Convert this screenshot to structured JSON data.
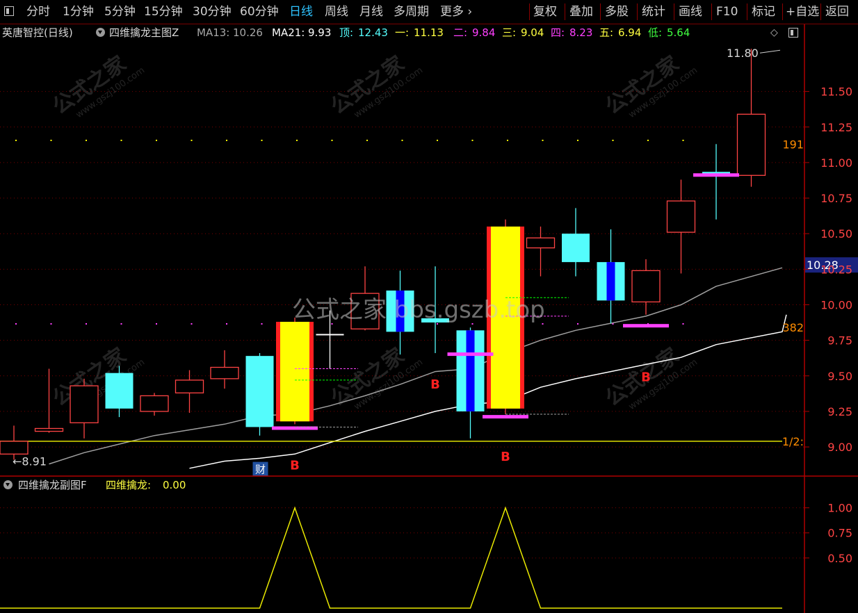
{
  "toolbar": {
    "left_items": [
      "分时",
      "1分钟",
      "5分钟",
      "15分钟",
      "30分钟",
      "60分钟",
      "日线",
      "周线",
      "月线",
      "多周期",
      "更多"
    ],
    "active_index": 6,
    "right_items": [
      "复权",
      "叠加",
      "多股",
      "统计",
      "画线",
      "F10",
      "标记",
      "+自选",
      "返回"
    ]
  },
  "header": {
    "stock": "英唐智控(日线)",
    "indicator": "四维擒龙主图Z",
    "ma13_label": "MA13:",
    "ma13_value": "10.26",
    "ma21_label": "MA21:",
    "ma21_value": "9.93",
    "top_label": "顶:",
    "top_value": "12.43",
    "l1_label": "一:",
    "l1_value": "11.13",
    "l2_label": "二:",
    "l2_value": "9.84",
    "l3_label": "三:",
    "l3_value": "9.04",
    "l4_label": "四:",
    "l4_value": "8.23",
    "l5_label": "五:",
    "l5_value": "6.94",
    "low_label": "低:",
    "low_value": "5.64"
  },
  "sub_header": {
    "indicator": "四维擒龙副图F",
    "value_label": "四维擒龙:",
    "value": "0.00"
  },
  "watermark": {
    "logo": "公式之家",
    "url": "www.gszj100.com",
    "center": "公式之家 bbs.gszb.top"
  },
  "colors": {
    "up_cyan": "#54fcfc",
    "down_red": "#ff4444",
    "yellow": "#ffff00",
    "magenta": "#ff40ff",
    "grid": "#8b0000",
    "ma13": "#a0a0a0",
    "ma21": "#ffffff",
    "accent": "#2ec3ff"
  },
  "chart_data": [
    {
      "type": "candlestick",
      "y_ticks": [
        9.0,
        9.25,
        9.5,
        9.75,
        10.0,
        10.25,
        10.5,
        10.75,
        11.0,
        11.25,
        11.5
      ],
      "ylim": [
        8.8,
        11.85
      ],
      "current_price": "10.28",
      "high_marker": "11.80",
      "low_marker": "8.91",
      "level_labels": [
        {
          "text": "191",
          "y": 11.13
        },
        {
          "text": "382",
          "y": 9.84
        },
        {
          "text": "1/2:",
          "y": 9.04
        }
      ],
      "candles": [
        {
          "o": 9.04,
          "c": 8.95,
          "h": 9.15,
          "l": 8.91,
          "kind": "hollow_red"
        },
        {
          "o": 9.11,
          "c": 9.13,
          "h": 9.55,
          "l": 9.1,
          "kind": "hollow_red"
        },
        {
          "o": 9.17,
          "c": 9.43,
          "h": 9.48,
          "l": 9.06,
          "kind": "hollow_red"
        },
        {
          "o": 9.52,
          "c": 9.27,
          "h": 9.57,
          "l": 9.21,
          "kind": "cyan"
        },
        {
          "o": 9.25,
          "c": 9.36,
          "h": 9.38,
          "l": 9.22,
          "kind": "hollow_red"
        },
        {
          "o": 9.38,
          "c": 9.47,
          "h": 9.54,
          "l": 9.24,
          "kind": "hollow_red"
        },
        {
          "o": 9.48,
          "c": 9.56,
          "h": 9.68,
          "l": 9.41,
          "kind": "hollow_red"
        },
        {
          "o": 9.64,
          "c": 9.14,
          "h": 9.66,
          "l": 9.08,
          "kind": "cyan"
        },
        {
          "o": 9.18,
          "c": 9.88,
          "h": 9.91,
          "l": 9.16,
          "kind": "yellow"
        },
        {
          "o": 9.79,
          "c": 9.78,
          "h": 9.96,
          "l": 9.55,
          "kind": "white_doji"
        },
        {
          "o": 9.83,
          "c": 10.08,
          "h": 10.27,
          "l": 9.82,
          "kind": "hollow_red"
        },
        {
          "o": 10.1,
          "c": 9.81,
          "h": 10.24,
          "l": 9.65,
          "kind": "cyan_blue"
        },
        {
          "o": 9.89,
          "c": 9.89,
          "h": 10.27,
          "l": 9.66,
          "kind": "cyan_doji"
        },
        {
          "o": 9.82,
          "c": 9.25,
          "h": 9.84,
          "l": 9.06,
          "kind": "cyan_blue"
        },
        {
          "o": 9.27,
          "c": 10.55,
          "h": 10.6,
          "l": 9.23,
          "kind": "yellow"
        },
        {
          "o": 10.4,
          "c": 10.47,
          "h": 10.55,
          "l": 10.2,
          "kind": "hollow_red"
        },
        {
          "o": 10.5,
          "c": 10.3,
          "h": 10.68,
          "l": 10.2,
          "kind": "cyan"
        },
        {
          "o": 10.3,
          "c": 10.03,
          "h": 10.53,
          "l": 9.87,
          "kind": "cyan_blue"
        },
        {
          "o": 10.02,
          "c": 10.24,
          "h": 10.32,
          "l": 9.93,
          "kind": "hollow_red"
        },
        {
          "o": 10.51,
          "c": 10.73,
          "h": 10.88,
          "l": 10.22,
          "kind": "hollow_red"
        },
        {
          "o": 10.92,
          "c": 10.92,
          "h": 11.13,
          "l": 10.6,
          "kind": "cyan_doji"
        },
        {
          "o": 10.91,
          "c": 11.34,
          "h": 11.8,
          "l": 10.83,
          "kind": "hollow_red"
        }
      ],
      "ma13": {
        "start_index": 1,
        "values": [
          8.88,
          8.96,
          9.02,
          9.08,
          9.12,
          9.16,
          9.22,
          9.23,
          9.29,
          9.36,
          9.44,
          9.53,
          9.55,
          9.66,
          9.75,
          9.82,
          9.87,
          9.92,
          10.0,
          10.13,
          10.26
        ]
      },
      "ma21": {
        "start_index": 5,
        "values": [
          8.85,
          8.9,
          8.92,
          8.95,
          9.03,
          9.11,
          9.18,
          9.25,
          9.3,
          9.32,
          9.42,
          9.48,
          9.53,
          9.58,
          9.63,
          9.72,
          9.81,
          9.93
        ]
      },
      "horizontal_line": {
        "y": 9.04
      },
      "magenta_bars": [
        {
          "index": 8,
          "y": 9.13
        },
        {
          "index": 13,
          "y": 9.65
        },
        {
          "index": 14,
          "y": 9.21
        },
        {
          "index": 18,
          "y": 9.85
        },
        {
          "index": 20,
          "y": 10.91
        }
      ],
      "dashed_lines": [
        {
          "from": 8,
          "to": 9.8,
          "y": 9.55,
          "color": "magenta"
        },
        {
          "from": 8,
          "to": 9.8,
          "y": 9.47,
          "color": "green"
        },
        {
          "from": 8,
          "to": 9.8,
          "y": 9.14,
          "color": "gray"
        },
        {
          "from": 14,
          "to": 15.8,
          "y": 10.05,
          "color": "green"
        },
        {
          "from": 14,
          "to": 15.8,
          "y": 9.92,
          "color": "magenta"
        },
        {
          "from": 14,
          "to": 15.8,
          "y": 9.23,
          "color": "gray"
        }
      ],
      "signals": [
        {
          "index": 8,
          "text": "B",
          "y": 8.93
        },
        {
          "index": 12,
          "text": "B",
          "y": 9.5
        },
        {
          "index": 14,
          "text": "B",
          "y": 8.99
        },
        {
          "index": 18,
          "text": "B",
          "y": 9.55
        }
      ],
      "badge": {
        "index": 7,
        "text": "财",
        "y": 8.89
      }
    },
    {
      "type": "line",
      "y_ticks": [
        0.5,
        0.75,
        1.0
      ],
      "ylim": [
        0,
        1.15
      ],
      "values": [
        0,
        0,
        0,
        0,
        0,
        0,
        0,
        0,
        1,
        0,
        0,
        0,
        0,
        0,
        1,
        0,
        0,
        0,
        0,
        0,
        0,
        0
      ]
    }
  ]
}
